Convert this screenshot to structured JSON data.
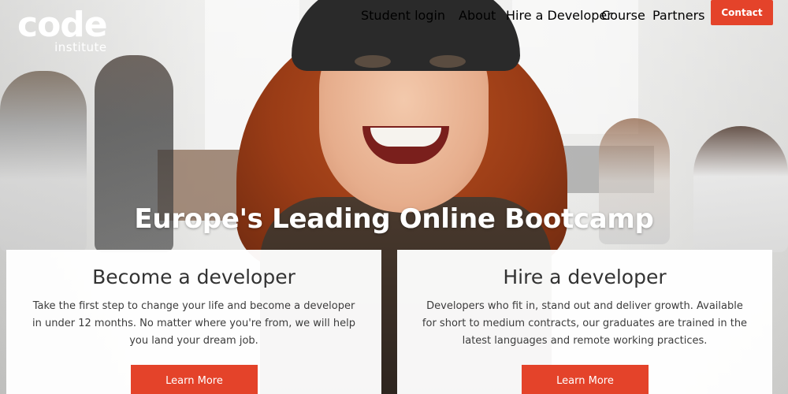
{
  "logo": {
    "main": "code",
    "sub": "institute"
  },
  "nav": {
    "student_login": "Student login",
    "about": "About",
    "hire_developer": "Hire a Developer",
    "course": "Course",
    "partners": "Partners",
    "contact": "Contact"
  },
  "hero": {
    "headline": "Europe's Leading Online Bootcamp"
  },
  "cards": [
    {
      "title": "Become a developer",
      "text": "Take the first step to change your life and become a developer in under 12 months. No matter where you're from, we will help you land your dream job.",
      "button": "Learn More"
    },
    {
      "title": "Hire a developer",
      "text": "Developers who fit in, stand out and deliver growth. Available for short to medium contracts, our graduates are trained in the latest languages and remote working practices.",
      "button": "Learn More"
    }
  ],
  "colors": {
    "accent": "#e4432a",
    "card_bg": "#ffffff",
    "text": "#333333"
  }
}
